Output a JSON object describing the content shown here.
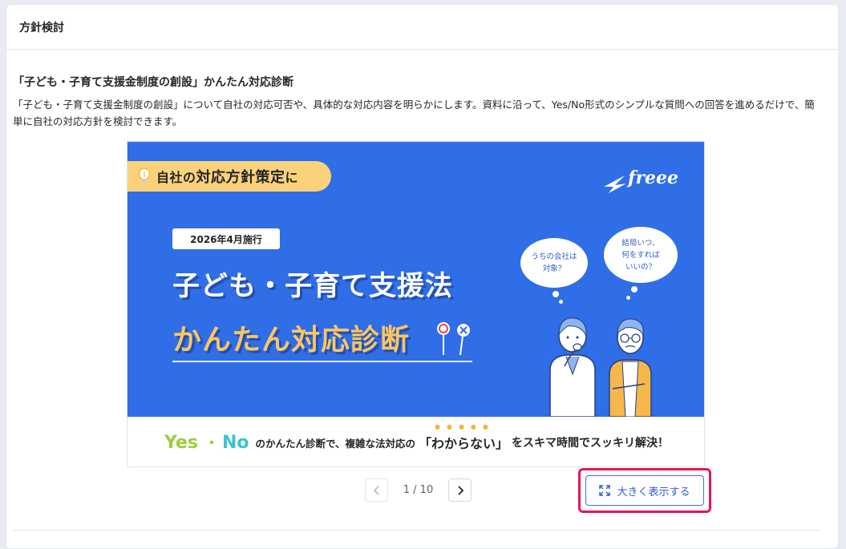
{
  "card": {
    "header_title": "方針検討"
  },
  "section": {
    "title": "「子ども・子育て支援金制度の創設」かんたん対応診断",
    "description": "「子ども・子育て支援金制度の創設」について自社の対応可否や、具体的な対応内容を明らかにします。資料に沿って、Yes/No形式のシンプルな質問への回答を進めるだけで、簡単に自社の対応方針を検討できます。"
  },
  "slide": {
    "tag_pre": "自社の",
    "tag_main": "対応方針策定",
    "tag_post": "に",
    "logo": "freee",
    "date_badge": "2026年4月施行",
    "headline1": "子ども・子育て支援法",
    "headline2": "かんたん対応診断",
    "bubble1_line1": "うちの会社は",
    "bubble1_line2": "対象？",
    "bubble2_line1": "結局いつ、",
    "bubble2_line2": "何をすれば",
    "bubble2_line3": "いいの？",
    "footer_yes": "Yes",
    "footer_sep": "・",
    "footer_no": "No",
    "footer_text1": "のかんたん診断で、複雑な法対応の",
    "footer_emph": "「わからない」",
    "footer_text2": "をスキマ時間でスッキリ解決！"
  },
  "pager": {
    "current_label": "1 / 10"
  },
  "enlarge": {
    "label": "大きく表示する"
  },
  "colors": {
    "slide_blue": "#2f6ee6",
    "accent_yellow": "#f9c662",
    "highlight_border": "#e0165e",
    "link_blue": "#2f5fd6"
  }
}
